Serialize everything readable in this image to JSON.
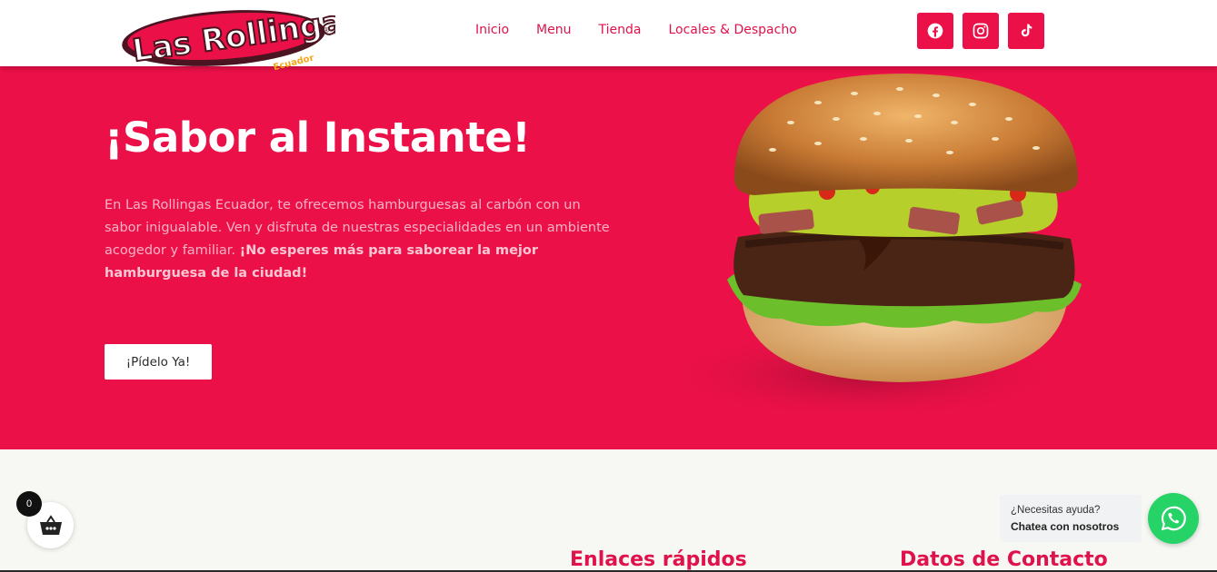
{
  "brand": {
    "logo_text": "Las Rollingas",
    "logo_subtext": "Ecuador",
    "logo_mark": "®",
    "primary_color": "#ec1048"
  },
  "nav": {
    "items": [
      "Inicio",
      "Menu",
      "Tienda",
      "Locales & Despacho"
    ]
  },
  "social": [
    {
      "icon": "facebook-icon"
    },
    {
      "icon": "instagram-icon"
    },
    {
      "icon": "tiktok-icon"
    }
  ],
  "hero": {
    "title": "¡Sabor al Instante!",
    "text": "En Las Rollingas Ecuador, te ofrecemos hamburguesas al carbón con un sabor inigualable. Ven y disfruta de nuestras especialidades en un ambiente acogedor y familiar.",
    "text_bold": "¡No esperes más para saborear la mejor hamburguesa de la ciudad!",
    "cta_label": "¡Pídelo Ya!"
  },
  "footer": {
    "quick_links_title": "Enlaces rápidos",
    "contact_title": "Datos de Contacto"
  },
  "cart": {
    "count": "0",
    "icon": "basket-icon"
  },
  "whatsapp": {
    "line1": "¿Necesitas ayuda?",
    "line2": "Chatea con nosotros",
    "icon": "whatsapp-icon",
    "color": "#25d366"
  }
}
